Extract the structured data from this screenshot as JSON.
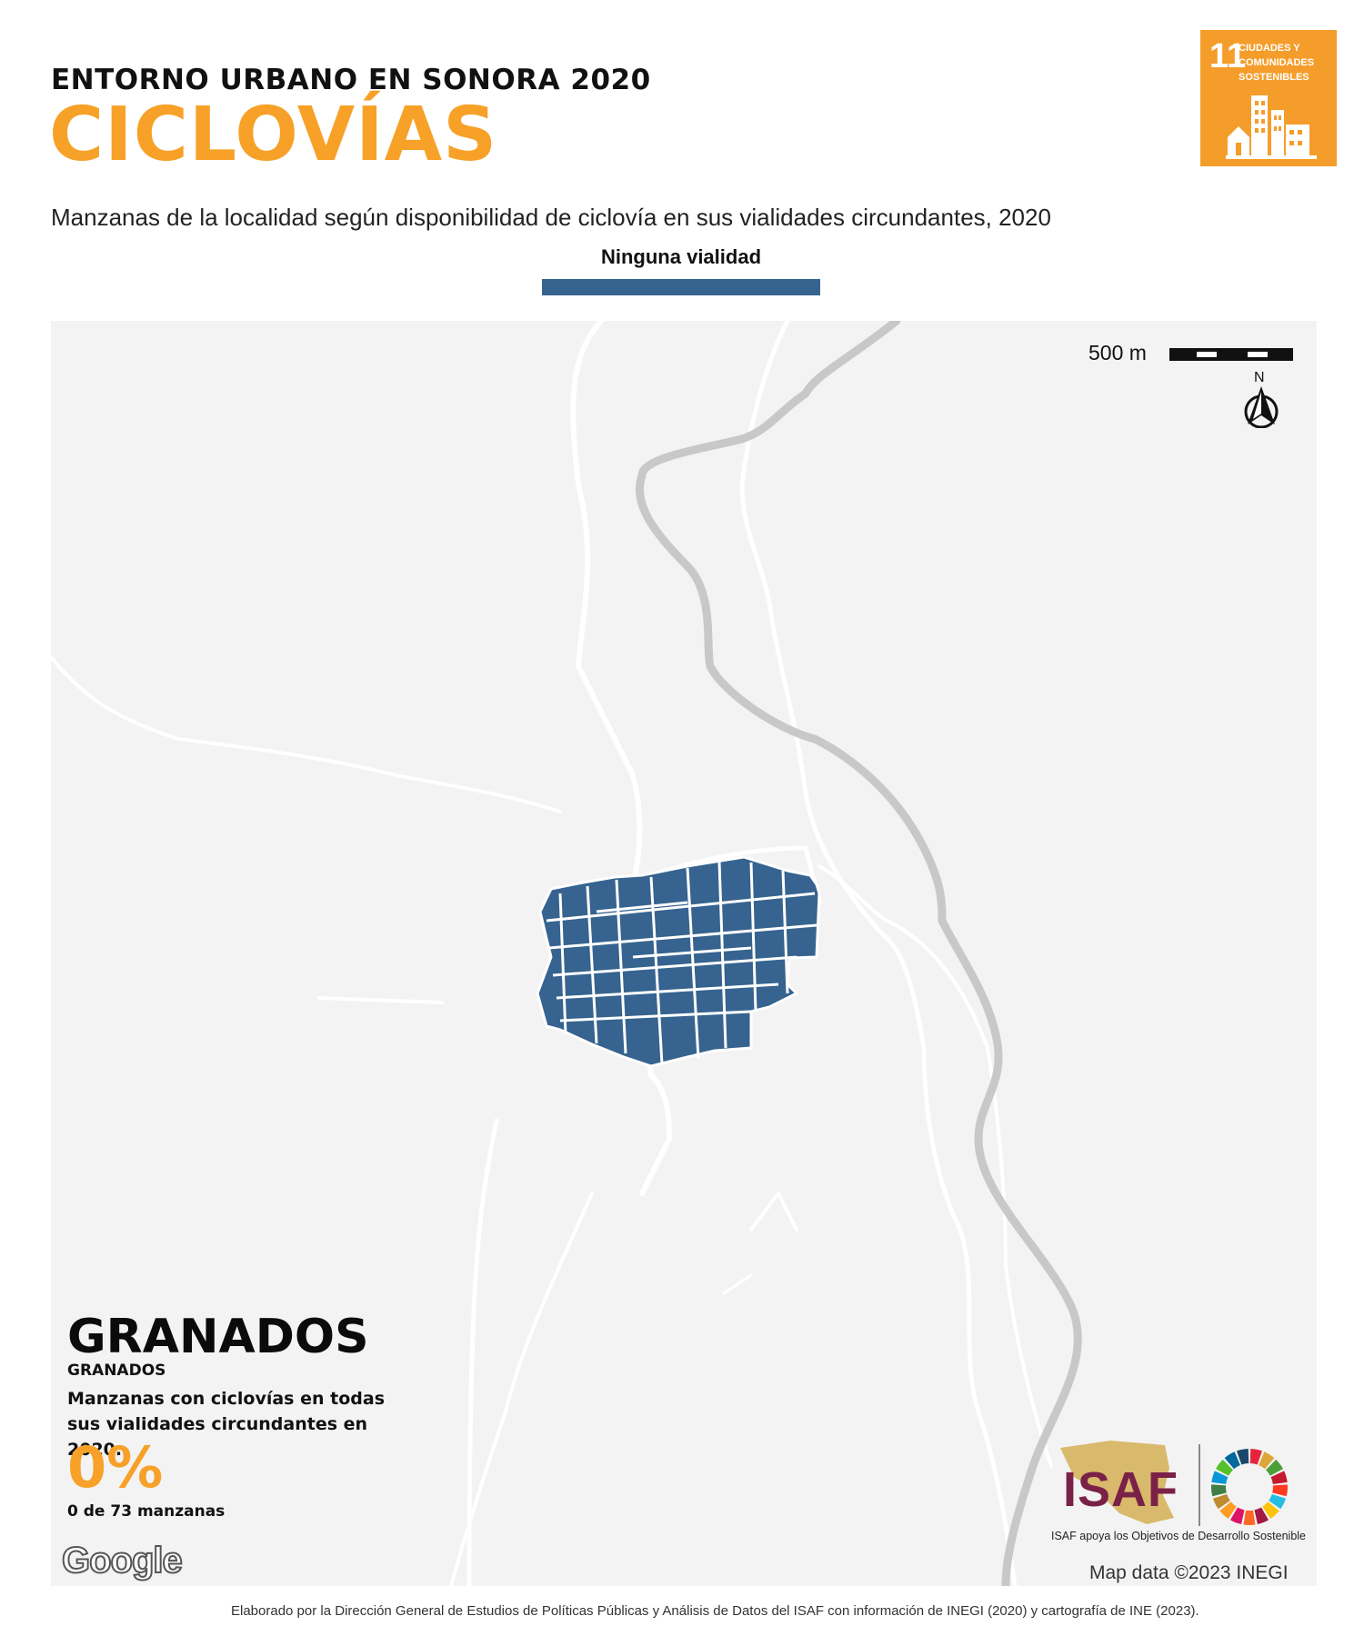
{
  "header": {
    "supertitle": "ENTORNO URBANO EN SONORA 2020",
    "title": "CICLOVÍAS",
    "subtitle": "Manzanas de la localidad según disponibilidad de ciclovía en sus vialidades circundantes, 2020"
  },
  "legend": {
    "label": "Ninguna vialidad",
    "color": "#36638f"
  },
  "sdg_badge": {
    "number": "11",
    "line1": "CIUDADES Y",
    "line2": "COMUNIDADES",
    "line3": "SOSTENIBLES",
    "color": "#f59d2a",
    "icon": "city-buildings-icon"
  },
  "map": {
    "scale_label": "500 m",
    "north_label": "N",
    "background_color": "#f3f3f3",
    "road_color": "#ffffff",
    "river_color": "#c8c8c8",
    "blocks_color": "#36638f",
    "mapdata": "Map data ©2023 INEGI",
    "google": "Google"
  },
  "stats": {
    "locality": "GRANADOS",
    "locality_sub": "GRANADOS",
    "description": "Manzanas con ciclovías en todas sus vialidades circundantes en 2020.",
    "percent": "0%",
    "count": "0 de 73 manzanas"
  },
  "isaf": {
    "logo_text": "ISAF",
    "caption": "ISAF apoya los Objetivos de Desarrollo Sostenible",
    "brand_color": "#7a2148"
  },
  "footer": {
    "credit": "Elaborado por la Dirección General de Estudios de Políticas Públicas y Análisis de Datos del ISAF con información de INEGI (2020) y cartografía de INE (2023)."
  }
}
